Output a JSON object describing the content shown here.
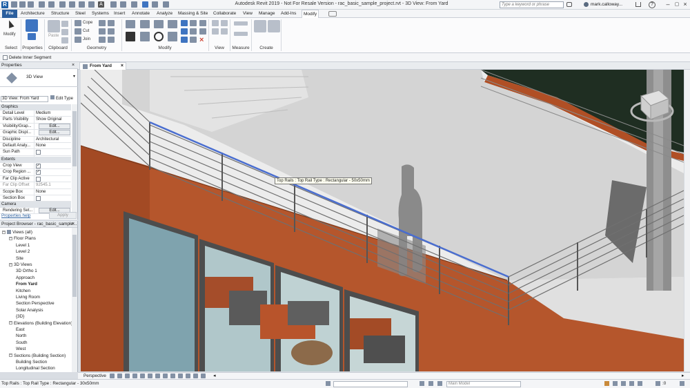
{
  "app": {
    "title": "Autodesk Revit 2019 - Not For Resale Version - rac_basic_sample_project.rvt - 3D View: From Yard",
    "search_placeholder": "Type a keyword or phrase",
    "user": "mark.calloway...",
    "colors": {
      "accent": "#2b5f9e",
      "wall": "#b5562c",
      "rail_highlight": "#4a6ed0",
      "floor": "#d6d6d6"
    }
  },
  "tabs": [
    "File",
    "Architecture",
    "Structure",
    "Steel",
    "Systems",
    "Insert",
    "Annotate",
    "Analyze",
    "Massing & Site",
    "Collaborate",
    "View",
    "Manage",
    "Add-Ins",
    "Modify"
  ],
  "ribbon": {
    "modify_label": "Modify",
    "properties_label": "Properties",
    "paste_label": "Paste",
    "cope_label": "Cope",
    "cut_label": "Cut",
    "join_label": "Join",
    "panels": {
      "select": "Select",
      "properties": "Properties",
      "clipboard": "Clipboard",
      "geometry": "Geometry",
      "modify": "Modify",
      "view": "View",
      "measure": "Measure",
      "create": "Create"
    }
  },
  "optionbar": {
    "delete_inner_segment": "Delete Inner Segment"
  },
  "properties": {
    "header": "Properties",
    "type_name": "3D View",
    "instance_selector": "3D View: From Yard",
    "edit_type": "Edit Type",
    "groups": {
      "graphics": "Graphics",
      "extents": "Extents",
      "camera": "Camera"
    },
    "rows_graphics": [
      {
        "k": "Detail Level",
        "v": "Medium"
      },
      {
        "k": "Parts Visibility",
        "v": "Show Original"
      },
      {
        "k": "Visibility/Grap...",
        "v": "Edit..."
      },
      {
        "k": "Graphic Displ...",
        "v": "Edit..."
      },
      {
        "k": "Discipline",
        "v": "Architectural"
      },
      {
        "k": "Default Analy...",
        "v": "None"
      },
      {
        "k": "Sun Path",
        "v": ""
      }
    ],
    "rows_extents": [
      {
        "k": "Crop View",
        "v": ""
      },
      {
        "k": "Crop Region ...",
        "v": ""
      },
      {
        "k": "Far Clip Active",
        "v": ""
      },
      {
        "k": "Far Clip Offset",
        "v": "92545.1"
      },
      {
        "k": "Scope Box",
        "v": "None"
      },
      {
        "k": "Section Box",
        "v": ""
      }
    ],
    "rows_camera": [
      {
        "k": "Rendering Set...",
        "v": "Edit..."
      }
    ],
    "help_link": "Properties help",
    "apply": "Apply"
  },
  "browser": {
    "header": "Project Browser - rac_basic_sample...",
    "nodes": [
      {
        "label": "Views (all)",
        "depth": 0,
        "toggle": "-"
      },
      {
        "label": "Floor Plans",
        "depth": 1,
        "toggle": "-"
      },
      {
        "label": "Level 1",
        "depth": 2
      },
      {
        "label": "Level 2",
        "depth": 2
      },
      {
        "label": "Site",
        "depth": 2
      },
      {
        "label": "3D Views",
        "depth": 1,
        "toggle": "-"
      },
      {
        "label": "3D Ortho 1",
        "depth": 2
      },
      {
        "label": "Approach",
        "depth": 2
      },
      {
        "label": "From Yard",
        "depth": 2,
        "selected": true
      },
      {
        "label": "Kitchen",
        "depth": 2
      },
      {
        "label": "Living Room",
        "depth": 2
      },
      {
        "label": "Section Perspective",
        "depth": 2
      },
      {
        "label": "Solar Analysis",
        "depth": 2
      },
      {
        "label": "{3D}",
        "depth": 2
      },
      {
        "label": "Elevations (Building Elevation)",
        "depth": 1,
        "toggle": "-"
      },
      {
        "label": "East",
        "depth": 2
      },
      {
        "label": "North",
        "depth": 2
      },
      {
        "label": "South",
        "depth": 2
      },
      {
        "label": "West",
        "depth": 2
      },
      {
        "label": "Sections (Building Section)",
        "depth": 1,
        "toggle": "-"
      },
      {
        "label": "Building Section",
        "depth": 2
      },
      {
        "label": "Longitudinal Section",
        "depth": 2
      }
    ]
  },
  "view": {
    "tab_label": "From Yard",
    "tooltip": "Top Rails : Top Rail Type : Rectangular - 50x50mm",
    "viewbar_label": "Perspective"
  },
  "status": {
    "message": "Top Rails : Top Rail Type : Rectangular - 30x50mm",
    "workset": "Main Model",
    "selection_count": ":0"
  }
}
